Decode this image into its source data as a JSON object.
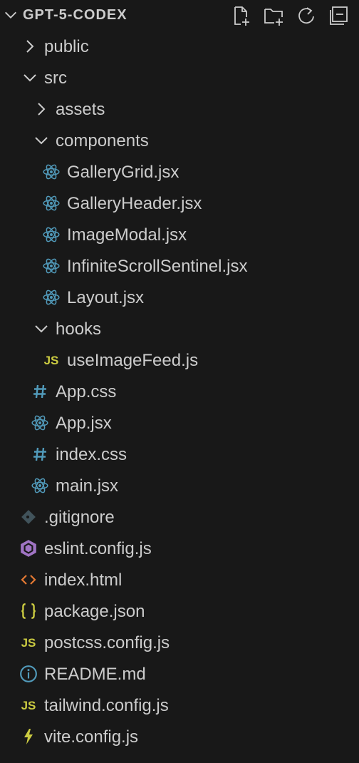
{
  "explorer": {
    "title": "GPT-5-CODEX",
    "actions": [
      {
        "name": "new-file-icon",
        "label": "New File"
      },
      {
        "name": "new-folder-icon",
        "label": "New Folder"
      },
      {
        "name": "refresh-icon",
        "label": "Refresh"
      },
      {
        "name": "collapse-all-icon",
        "label": "Collapse All"
      }
    ]
  },
  "tree": [
    {
      "name": "public",
      "type": "folder",
      "depth": 1,
      "expanded": false
    },
    {
      "name": "src",
      "type": "folder",
      "depth": 1,
      "expanded": true
    },
    {
      "name": "assets",
      "type": "folder",
      "depth": 2,
      "expanded": false
    },
    {
      "name": "components",
      "type": "folder",
      "depth": 2,
      "expanded": true
    },
    {
      "name": "GalleryGrid.jsx",
      "type": "file",
      "depth": 3,
      "icon": "react-icon",
      "color": "#519aba"
    },
    {
      "name": "GalleryHeader.jsx",
      "type": "file",
      "depth": 3,
      "icon": "react-icon",
      "color": "#519aba"
    },
    {
      "name": "ImageModal.jsx",
      "type": "file",
      "depth": 3,
      "icon": "react-icon",
      "color": "#519aba"
    },
    {
      "name": "InfiniteScrollSentinel.jsx",
      "type": "file",
      "depth": 3,
      "icon": "react-icon",
      "color": "#519aba"
    },
    {
      "name": "Layout.jsx",
      "type": "file",
      "depth": 3,
      "icon": "react-icon",
      "color": "#519aba"
    },
    {
      "name": "hooks",
      "type": "folder",
      "depth": 2,
      "expanded": true
    },
    {
      "name": "useImageFeed.js",
      "type": "file",
      "depth": 3,
      "icon": "js-icon",
      "glyph": "JS",
      "color": "#cbcb41"
    },
    {
      "name": "App.css",
      "type": "file",
      "depth": 2,
      "icon": "css-icon",
      "glyph": "#",
      "color": "#519aba"
    },
    {
      "name": "App.jsx",
      "type": "file",
      "depth": 2,
      "icon": "react-icon",
      "color": "#519aba"
    },
    {
      "name": "index.css",
      "type": "file",
      "depth": 2,
      "icon": "css-icon",
      "glyph": "#",
      "color": "#519aba"
    },
    {
      "name": "main.jsx",
      "type": "file",
      "depth": 2,
      "icon": "react-icon",
      "color": "#519aba"
    },
    {
      "name": ".gitignore",
      "type": "file",
      "depth": 1,
      "icon": "git-icon",
      "color": "#41535b"
    },
    {
      "name": "eslint.config.js",
      "type": "file",
      "depth": 1,
      "icon": "eslint-icon",
      "color": "#a074c4"
    },
    {
      "name": "index.html",
      "type": "file",
      "depth": 1,
      "icon": "html-icon",
      "glyph": "<>",
      "color": "#e37933"
    },
    {
      "name": "package.json",
      "type": "file",
      "depth": 1,
      "icon": "json-icon",
      "glyph": "{ }",
      "color": "#cbcb41"
    },
    {
      "name": "postcss.config.js",
      "type": "file",
      "depth": 1,
      "icon": "js-icon",
      "glyph": "JS",
      "color": "#cbcb41"
    },
    {
      "name": "README.md",
      "type": "file",
      "depth": 1,
      "icon": "info-icon",
      "color": "#519aba"
    },
    {
      "name": "tailwind.config.js",
      "type": "file",
      "depth": 1,
      "icon": "js-icon",
      "glyph": "JS",
      "color": "#cbcb41"
    },
    {
      "name": "vite.config.js",
      "type": "file",
      "depth": 1,
      "icon": "vite-icon",
      "color": "#cbcb41"
    }
  ],
  "colors": {
    "background": "#181818",
    "text": "#cccccc",
    "icon_muted": "#cccccc",
    "guide": "#3a3a3a"
  }
}
